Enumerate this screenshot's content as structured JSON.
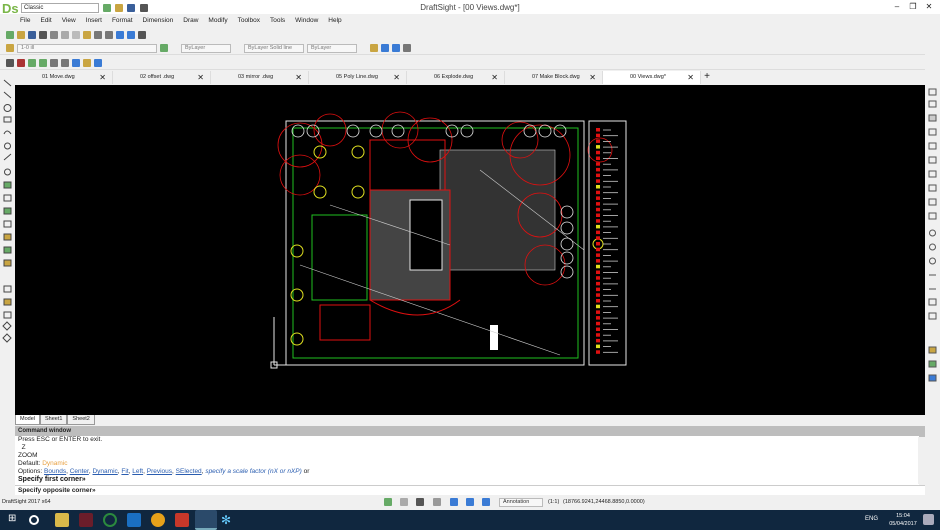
{
  "app": {
    "title": "DraftSight - [00 Views.dwg*]",
    "workspace": "Classic",
    "version": "DraftSight 2017 x64"
  },
  "menu": [
    "File",
    "Edit",
    "View",
    "Insert",
    "Format",
    "Dimension",
    "Draw",
    "Modify",
    "Toolbox",
    "Tools",
    "Window",
    "Help"
  ],
  "properties": {
    "layer": "1-0 ill",
    "color": "ByLayer",
    "linestyle": "ByLayer",
    "linestyle_type": "Solid line",
    "lineweight": "ByLayer"
  },
  "tabs": [
    {
      "label": "01 Move.dwg"
    },
    {
      "label": "02 offset .dwg"
    },
    {
      "label": "03 mirror .dwg"
    },
    {
      "label": "05 Poly Line.dwg"
    },
    {
      "label": "06 Explode.dwg"
    },
    {
      "label": "07 Make Block.dwg"
    },
    {
      "label": "00 Views.dwg*",
      "active": true
    }
  ],
  "close_glyph": "✕",
  "new_tab_glyph": "+",
  "sheets": [
    "Model",
    "Sheet1",
    "Sheet2"
  ],
  "command": {
    "title": "Command window",
    "lines": [
      "Press ESC or ENTER to exit.",
      "  Z",
      "ZOOM"
    ],
    "default_label": "Default:",
    "default_value": "Dynamic",
    "options_label": "Options:",
    "options": [
      "Bounds",
      "Center",
      "Dynamic",
      "Fit",
      "Left",
      "Previous",
      "SElected"
    ],
    "options_tail": "specify a scale factor (nX or nXP)",
    "options_or": "or",
    "prompt1": "Specify first corner»",
    "prompt2": "Specify opposite corner»"
  },
  "status": {
    "annotation": "Annotation",
    "scale": "(1:1)",
    "coords": "(18766.9241,24468.8850,0.0000)"
  },
  "taskbar": {
    "lang": "ENG",
    "time": "15:04",
    "date": "05/04/2017"
  },
  "colors": {
    "canvas": "#000000",
    "drawing_red": "#e01010",
    "drawing_white": "#e6e6e6",
    "drawing_green": "#20c020",
    "drawing_yellow": "#e0e020",
    "taskbar": "#10273f"
  }
}
